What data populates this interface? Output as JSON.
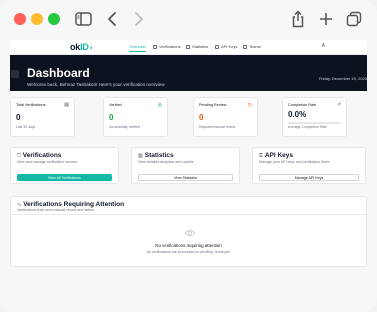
{
  "app": {
    "logo_main": "ok",
    "logo_accent": "ID"
  },
  "nav": {
    "items": [
      {
        "label": "Overview",
        "active": true
      },
      {
        "label": "Verifications",
        "active": false
      },
      {
        "label": "Statistics",
        "active": false
      },
      {
        "label": "API Keys",
        "active": false
      },
      {
        "label": "Teams",
        "active": false
      }
    ],
    "user_initial": "A"
  },
  "hero": {
    "title": "Dashboard",
    "subtitle": "Welcome back, Behnaz Tashakori! Here's your verification overview",
    "date": "Friday, December 19, 2025"
  },
  "stats": [
    {
      "label": "Total Verifications",
      "value": "0",
      "caption": "Last 30 days",
      "color": "#111827",
      "icon": "document-icon"
    },
    {
      "label": "Verified",
      "value": "0",
      "caption": "Successfully verified",
      "color": "#16a34a",
      "icon": "check-circle-icon"
    },
    {
      "label": "Pending Review",
      "value": "0",
      "caption": "Requires manual review",
      "color": "#ea580c",
      "icon": "clock-icon"
    },
    {
      "label": "Completion Rate",
      "value": "0.0%",
      "caption": "Average Completion Rate",
      "color": "#111827",
      "icon": "trend-up-icon",
      "progress": 0
    }
  ],
  "cards": [
    {
      "title": "Verifications",
      "desc": "View and manage verification records",
      "button": "View All Verifications"
    },
    {
      "title": "Statistics",
      "desc": "View detailed analytics and reports",
      "button": "View Statistics"
    },
    {
      "title": "API Keys",
      "desc": "Manage your API keys and verification flows",
      "button": "Manage API Keys"
    }
  ],
  "attention": {
    "title": "Verifications Requiring Attention",
    "desc": "Verifications that need manual review and action",
    "empty_title": "No verifications requiring attention",
    "empty_sub": "All verifications are processed or pending. Great job!"
  },
  "colors": {
    "accent": "#14b8a6",
    "hero_bg": "#0d1220"
  }
}
